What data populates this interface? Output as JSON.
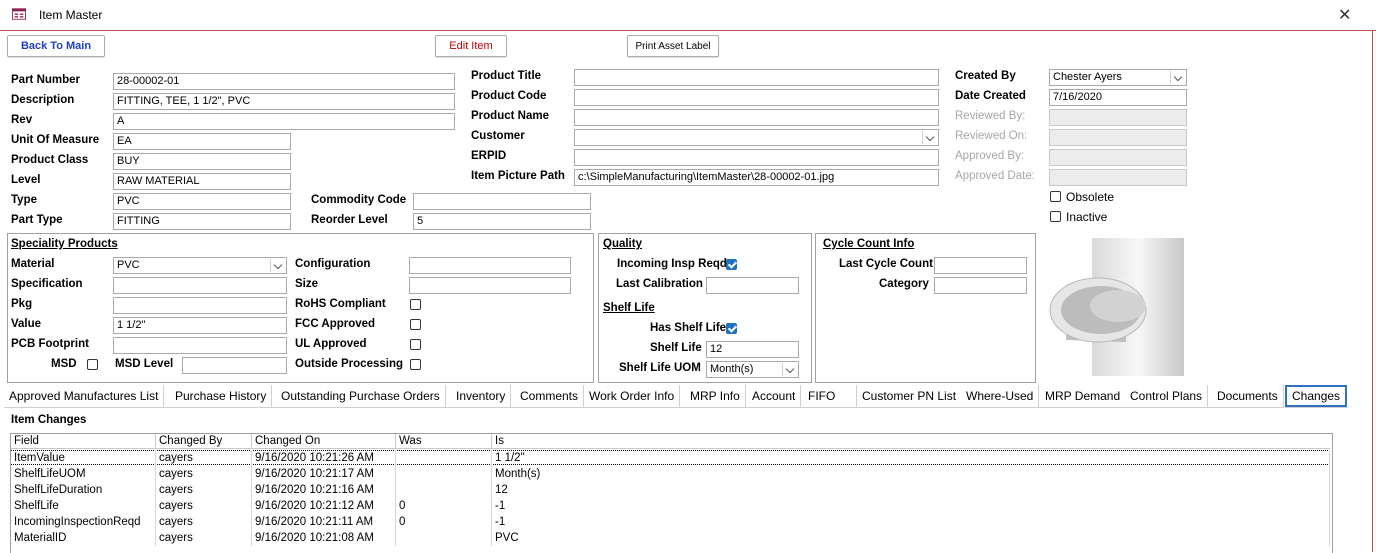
{
  "window": {
    "title": "Item Master",
    "close_glyph": "✕"
  },
  "buttons": {
    "back": "Back To Main",
    "edit": "Edit Item",
    "print": "Print Asset Label"
  },
  "left": {
    "part_number_label": "Part Number",
    "part_number": "28-00002-01",
    "description_label": "Description",
    "description": "FITTING, TEE, 1 1/2\", PVC",
    "rev_label": "Rev",
    "rev": "A",
    "uom_label": "Unit Of Measure",
    "uom": "EA",
    "product_class_label": "Product Class",
    "product_class": "BUY",
    "level_label": "Level",
    "level": "RAW MATERIAL",
    "type_label": "Type",
    "type": "PVC",
    "part_type_label": "Part Type",
    "part_type": "FITTING",
    "commodity_code_label": "Commodity Code",
    "commodity_code": "",
    "reorder_level_label": "Reorder Level",
    "reorder_level": "5"
  },
  "product": {
    "title_label": "Product Title",
    "title": "",
    "code_label": "Product Code",
    "code": "",
    "name_label": "Product Name",
    "name": "",
    "customer_label": "Customer",
    "customer": "",
    "erpid_label": "ERPID",
    "erpid": "",
    "picture_path_label": "Item Picture Path",
    "picture_path": "c:\\SimpleManufacturing\\ItemMaster\\28-00002-01.jpg"
  },
  "audit": {
    "created_by_label": "Created By",
    "created_by": "Chester Ayers",
    "date_created_label": "Date Created",
    "date_created": "7/16/2020",
    "reviewed_by_label": "Reviewed By:",
    "reviewed_on_label": "Reviewed On:",
    "approved_by_label": "Approved By:",
    "approved_date_label": "Approved Date:",
    "obsolete_label": "Obsolete",
    "obsolete": false,
    "inactive_label": "Inactive",
    "inactive": false
  },
  "speciality": {
    "header": "Speciality Products",
    "material_label": "Material",
    "material": "PVC",
    "specification_label": "Specification",
    "specification": "",
    "pkg_label": "Pkg",
    "pkg": "",
    "value_label": "Value",
    "value": "1 1/2\"",
    "pcb_label": "PCB Footprint",
    "pcb": "",
    "msd_label": "MSD",
    "msd": false,
    "msd_level_label": "MSD Level",
    "msd_level": "",
    "configuration_label": "Configuration",
    "configuration": "",
    "size_label": "Size",
    "size": "",
    "rohs_label": "RoHS Compliant",
    "rohs": false,
    "fcc_label": "FCC Approved",
    "fcc": false,
    "ul_label": "UL Approved",
    "ul": false,
    "outside_label": "Outside Processing",
    "outside": false
  },
  "quality": {
    "header": "Quality",
    "incoming_label": "Incoming Insp Reqd",
    "incoming": true,
    "last_cal_label": "Last Calibration",
    "last_cal": "",
    "shelf_header": "Shelf Life",
    "has_shelf_label": "Has Shelf Life",
    "has_shelf": true,
    "shelf_label": "Shelf Life",
    "shelf": "12",
    "shelf_uom_label": "Shelf Life UOM",
    "shelf_uom": "Month(s)"
  },
  "cycle": {
    "header": "Cycle Count Info",
    "last_label": "Last Cycle Count",
    "last": "",
    "category_label": "Category",
    "category": ""
  },
  "tabs": [
    "Approved Manufactures List",
    "Purchase History",
    "Outstanding Purchase Orders",
    "Inventory",
    "Comments",
    "Work Order Info",
    "MRP Info",
    "Account",
    "FIFO",
    "Customer PN List",
    "Where-Used",
    "MRP Demand",
    "Control Plans",
    "Documents",
    "Changes"
  ],
  "changes": {
    "header": "Item Changes",
    "columns": [
      "Field",
      "Changed By",
      "Changed On",
      "Was",
      "Is"
    ],
    "rows": [
      [
        "ItemValue",
        "cayers",
        "9/16/2020 10:21:26 AM",
        "",
        "1 1/2\""
      ],
      [
        "ShelfLifeUOM",
        "cayers",
        "9/16/2020 10:21:17 AM",
        "",
        "Month(s)"
      ],
      [
        "ShelfLifeDuration",
        "cayers",
        "9/16/2020 10:21:16 AM",
        "",
        "12"
      ],
      [
        "ShelfLife",
        "cayers",
        "9/16/2020 10:21:12 AM",
        "0",
        "-1"
      ],
      [
        "IncomingInspectionReqd",
        "cayers",
        "9/16/2020 10:21:11 AM",
        "0",
        "-1"
      ],
      [
        "MaterialID",
        "cayers",
        "9/16/2020 10:21:08 AM",
        "",
        "PVC"
      ]
    ]
  },
  "colors": {
    "accent_blue": "#1e73be",
    "edit_red": "#c00000",
    "back_blue": "#1f3fbf",
    "title_rule": "#c0504d"
  }
}
